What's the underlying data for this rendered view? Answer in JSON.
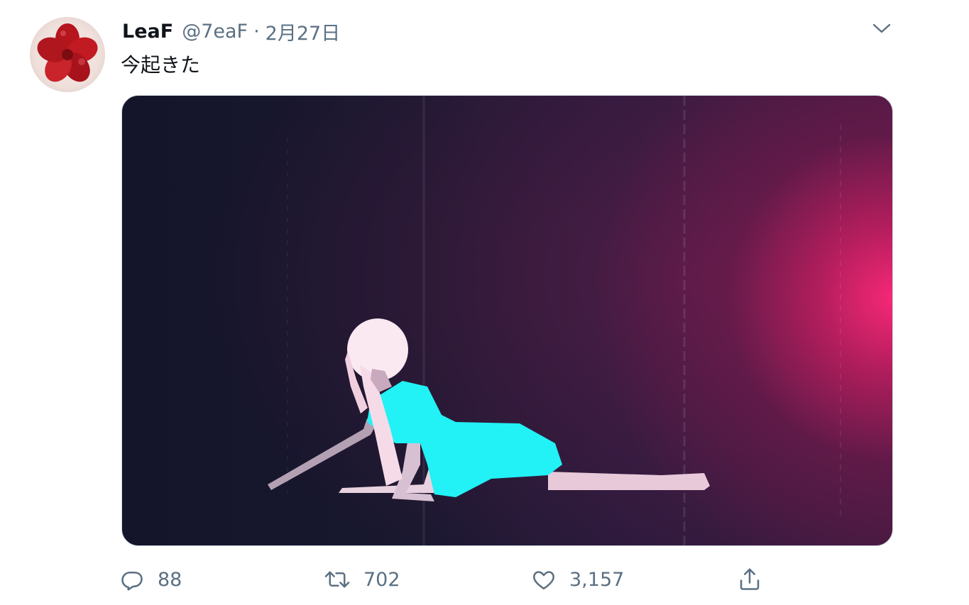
{
  "tweet": {
    "author": {
      "display_name": "LeaF",
      "handle": "@7eaF",
      "avatar_icon": "red-flower-avatar"
    },
    "separator": "·",
    "date": "2月27日",
    "text": "今起きた",
    "media": {
      "type": "gif",
      "description_icon": "pixel-art-girl-lying-on-floor"
    },
    "actions": {
      "reply": {
        "icon": "reply-icon",
        "count": "88"
      },
      "retweet": {
        "icon": "retweet-icon",
        "count": "702"
      },
      "like": {
        "icon": "heart-icon",
        "count": "3,157"
      },
      "share": {
        "icon": "share-icon"
      }
    },
    "more_icon": "chevron-down-icon"
  },
  "colors": {
    "secondary_text": "#5b7083",
    "primary_text": "#0f1419",
    "media_accent": "#ff2a78",
    "figure_dress": "#22f1f6"
  }
}
